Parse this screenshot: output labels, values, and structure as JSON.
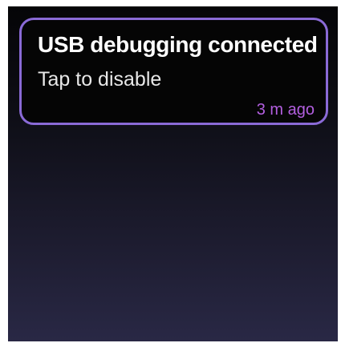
{
  "notification": {
    "title": "USB debugging connected",
    "subtitle": "Tap to disable",
    "timestamp": "3 m ago"
  },
  "colors": {
    "card_border": "#8a6ad6",
    "timestamp": "#b35fe0",
    "card_background": "#050505"
  }
}
